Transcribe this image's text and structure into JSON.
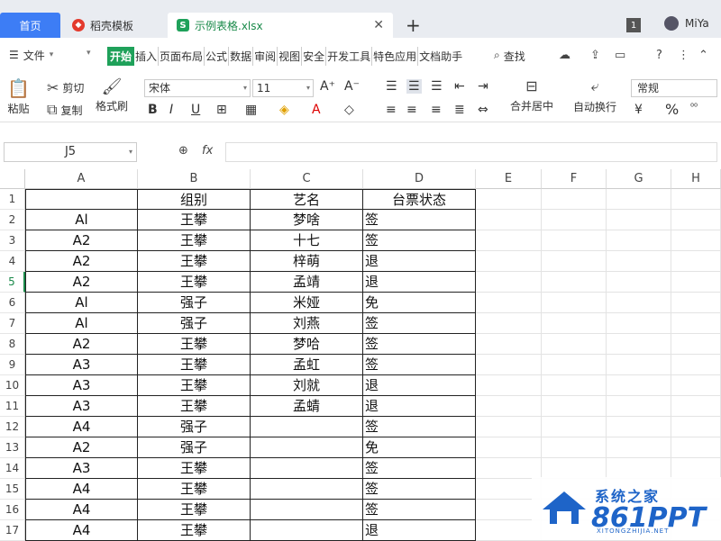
{
  "tabs": {
    "home": "首页",
    "doc": "稻壳模板",
    "active": "示例表格.xlsx",
    "window_count": "1",
    "user": "MiYa"
  },
  "menu": {
    "file": "文件",
    "items": [
      "开始",
      "插入",
      "页面布局",
      "公式",
      "数据",
      "审阅",
      "视图",
      "安全",
      "开发工具",
      "特色应用",
      "文档助手"
    ],
    "search": "查找"
  },
  "ribbon": {
    "paste": "粘贴",
    "cut": "剪切",
    "copy": "复制",
    "format_painter": "格式刷",
    "font": "宋体",
    "size": "11",
    "merge": "合并居中",
    "wrap": "自动换行",
    "number_style": "常规",
    "percent": "%"
  },
  "formula_bar": {
    "cell_ref": "J5",
    "fx": "fx"
  },
  "columns": [
    "A",
    "B",
    "C",
    "D",
    "E",
    "F",
    "G",
    "H"
  ],
  "headers": [
    "",
    "组别",
    "艺名",
    "台票状态"
  ],
  "rows": [
    [
      "Al",
      "王攀",
      "梦啥",
      "签"
    ],
    [
      "A2",
      "王攀",
      "十七",
      "签"
    ],
    [
      "A2",
      "王攀",
      "梓萌",
      "退"
    ],
    [
      "A2",
      "王攀",
      "孟靖",
      "退"
    ],
    [
      "Al",
      "强子",
      "米娅",
      "免"
    ],
    [
      "Al",
      "强子",
      "刘燕",
      "签"
    ],
    [
      "A2",
      "王攀",
      "梦哈",
      "签"
    ],
    [
      "A3",
      "王攀",
      "孟虹",
      "签"
    ],
    [
      "A3",
      "王攀",
      "刘就",
      "退"
    ],
    [
      "A3",
      "王攀",
      "孟蜻",
      "退"
    ],
    [
      "A4",
      "强子",
      "",
      "签"
    ],
    [
      "A2",
      "强子",
      "",
      "免"
    ],
    [
      "A3",
      "王攀",
      "",
      "签"
    ],
    [
      "A4",
      "王攀",
      "",
      "签"
    ],
    [
      "A4",
      "王攀",
      "",
      "签"
    ],
    [
      "A4",
      "王攀",
      "",
      "退"
    ]
  ],
  "row_numbers": [
    "1",
    "2",
    "3",
    "4",
    "5",
    "6",
    "7",
    "8",
    "9",
    "10",
    "11",
    "12",
    "13",
    "14",
    "15",
    "16",
    "17"
  ],
  "watermark": {
    "line1": "系统之家",
    "line2": "861PPT",
    "line3": "XITONGZHIJIA.NET"
  }
}
